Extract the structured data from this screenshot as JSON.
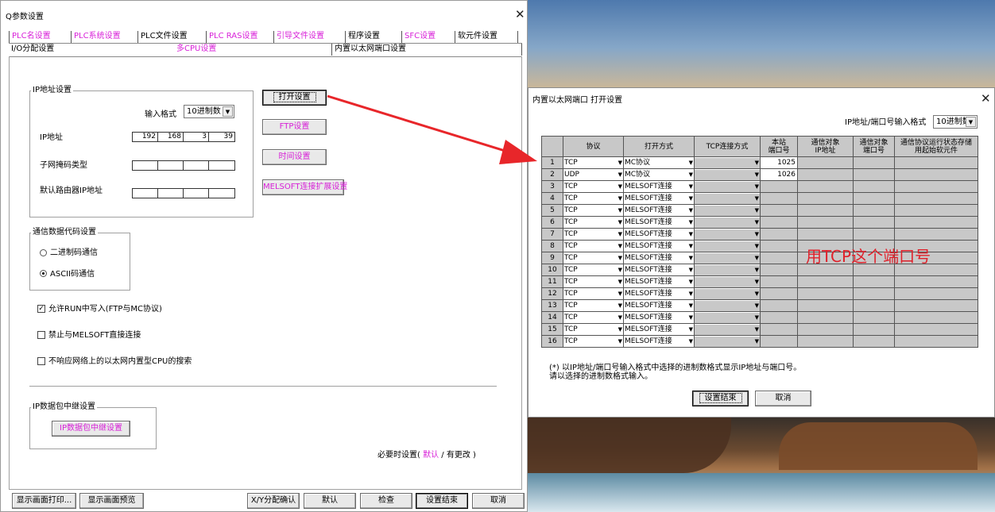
{
  "main": {
    "title": "Q参数设置",
    "close": "✕",
    "tabs_row1": [
      {
        "label": "PLC名设置",
        "color": "mag"
      },
      {
        "label": "PLC系统设置",
        "color": "mag"
      },
      {
        "label": "PLC文件设置",
        "color": "blk"
      },
      {
        "label": "PLC RAS设置",
        "color": "mag"
      },
      {
        "label": "引导文件设置",
        "color": "mag"
      },
      {
        "label": "程序设置",
        "color": "blk"
      },
      {
        "label": "SFC设置",
        "color": "mag"
      },
      {
        "label": "软元件设置",
        "color": "blk"
      }
    ],
    "tabs_row2": [
      {
        "label": "I/O分配设置",
        "color": "blk"
      },
      {
        "label": "多CPU设置",
        "color": "mag"
      },
      {
        "label": "内置以太网端口设置",
        "color": "blk"
      }
    ],
    "ip": {
      "group_title": "IP地址设置",
      "input_format_label": "输入格式",
      "input_format_value": "10进制数",
      "ip_label": "IP地址",
      "ip_values": [
        "192",
        "168",
        "3",
        "39"
      ],
      "subnet_label": "子网掩码类型",
      "subnet_values": [
        "",
        "",
        "",
        ""
      ],
      "gateway_label": "默认路由器IP地址",
      "gateway_values": [
        "",
        "",
        "",
        ""
      ]
    },
    "buttons": {
      "open_settings": "打开设置",
      "ftp_settings": "FTP设置",
      "time_settings": "时间设置",
      "melsoft_ext": "MELSOFT连接扩展设置",
      "ip_relay": "IP数据包中继设置"
    },
    "comm": {
      "group_title": "通信数据代码设置",
      "binary": "二进制码通信",
      "ascii": "ASCII码通信"
    },
    "checks": {
      "allow_run_write": "允许RUN中写入(FTP与MC协议)",
      "allow_run_write_checked": "✓",
      "forbid_melsoft": "禁止与MELSOFT直接连接",
      "no_respond_search": "不响应网络上的以太网内置型CPU的搜索"
    },
    "relay_group_title": "IP数据包中继设置",
    "required": {
      "prefix": "必要时设置(",
      "default": "默认",
      "sep": "/",
      "changed": "有更改",
      "suffix": ")"
    },
    "bottom": {
      "print": "显示画面打印...",
      "preview": "显示画面预览",
      "xy_confirm": "X/Y分配确认",
      "default": "默认",
      "check": "检查",
      "finish": "设置结束",
      "cancel": "取消"
    }
  },
  "dialog": {
    "title": "内置以太网端口 打开设置",
    "close": "✕",
    "format_label": "IP地址/端口号输入格式",
    "format_value": "10进制数",
    "headers": {
      "protocol": "协议",
      "open_method": "打开方式",
      "tcp_method": "TCP连接方式",
      "local_port_1": "本站",
      "local_port_2": "端口号",
      "target_ip_1": "通信对象",
      "target_ip_2": "IP地址",
      "target_port_1": "通信对象",
      "target_port_2": "端口号",
      "status_dev_1": "通信协议运行状态存储",
      "status_dev_2": "用起始软元件"
    },
    "rows": [
      {
        "n": "1",
        "protocol": "TCP",
        "open": "MC协议",
        "port": "1025"
      },
      {
        "n": "2",
        "protocol": "UDP",
        "open": "MC协议",
        "port": "1026"
      },
      {
        "n": "3",
        "protocol": "TCP",
        "open": "MELSOFT连接",
        "port": ""
      },
      {
        "n": "4",
        "protocol": "TCP",
        "open": "MELSOFT连接",
        "port": ""
      },
      {
        "n": "5",
        "protocol": "TCP",
        "open": "MELSOFT连接",
        "port": ""
      },
      {
        "n": "6",
        "protocol": "TCP",
        "open": "MELSOFT连接",
        "port": ""
      },
      {
        "n": "7",
        "protocol": "TCP",
        "open": "MELSOFT连接",
        "port": ""
      },
      {
        "n": "8",
        "protocol": "TCP",
        "open": "MELSOFT连接",
        "port": ""
      },
      {
        "n": "9",
        "protocol": "TCP",
        "open": "MELSOFT连接",
        "port": ""
      },
      {
        "n": "10",
        "protocol": "TCP",
        "open": "MELSOFT连接",
        "port": ""
      },
      {
        "n": "11",
        "protocol": "TCP",
        "open": "MELSOFT连接",
        "port": ""
      },
      {
        "n": "12",
        "protocol": "TCP",
        "open": "MELSOFT连接",
        "port": ""
      },
      {
        "n": "13",
        "protocol": "TCP",
        "open": "MELSOFT连接",
        "port": ""
      },
      {
        "n": "14",
        "protocol": "TCP",
        "open": "MELSOFT连接",
        "port": ""
      },
      {
        "n": "15",
        "protocol": "TCP",
        "open": "MELSOFT连接",
        "port": ""
      },
      {
        "n": "16",
        "protocol": "TCP",
        "open": "MELSOFT连接",
        "port": ""
      }
    ],
    "annotation": "用TCP这个端口号",
    "annotation_color": "#e0202a",
    "note_line1": "(*) 以IP地址/端口号输入格式中选择的进制数格式显示IP地址与端口号。",
    "note_line2": "请以选择的进制数格式输入。",
    "finish": "设置结束",
    "cancel": "取消"
  },
  "colors": {
    "magenta_label": "#d81fd8",
    "arrow_red": "#e8262a",
    "grid_gray": "#c8c8c8"
  }
}
